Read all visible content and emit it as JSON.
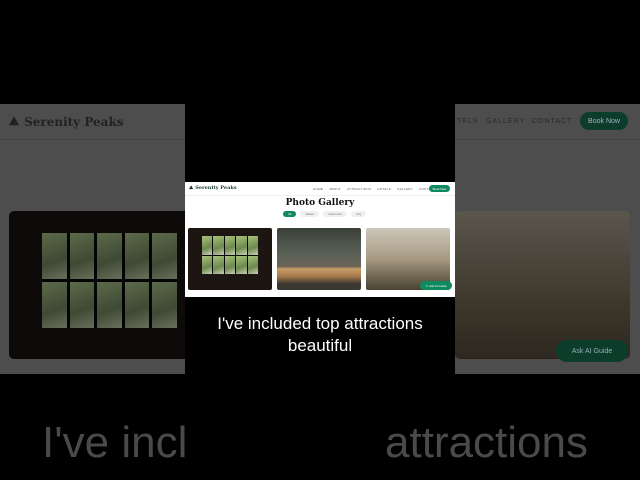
{
  "site": {
    "brand": "Serenity Peaks",
    "nav": [
      "HOME",
      "ABOUT",
      "ATTRACTIONS",
      "HOTELS",
      "GALLERY",
      "CONTACT"
    ],
    "book_label": "Book Now",
    "page_title": "Photo Gallery",
    "filters": [
      "All",
      "Nature",
      "Adventure",
      "City"
    ],
    "active_filter": "All",
    "ai_button": "Ask AI Guide",
    "accent": "#0f8a5f"
  },
  "background": {
    "nav_visible": [
      "TELS",
      "GALLERY",
      "CONTACT"
    ]
  },
  "caption": {
    "line1": "I've included top attractions",
    "line2": "beautiful",
    "big_left": "I've incl",
    "big_right": "attractions"
  }
}
